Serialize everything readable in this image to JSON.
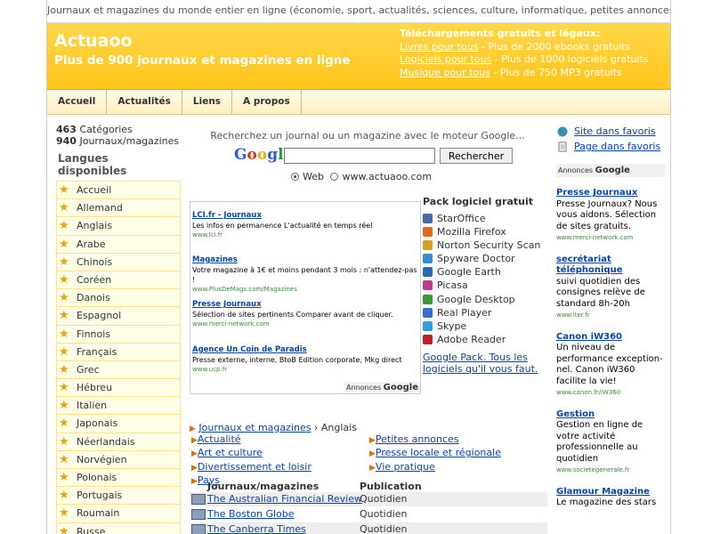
{
  "topbar": "Journaux et magazines du monde entier en ligne (économie, sport, actualités, sciences, culture, informatique, petites annonces...)",
  "header": {
    "title": "Actuaoo",
    "subtitle": "Plus de 900 journaux et magazines en ligne",
    "downloads_title": "Téléchargements gratuits et légaux:",
    "downloads": [
      {
        "link": "Livres pour tous",
        "text": " - Plus de 2000 ebooks gratuits"
      },
      {
        "link": "Logiciels pour tous",
        "text": " - Plus de 1000 logiciels gratuits"
      },
      {
        "link": "Musique pour tous",
        "text": " - Plus de 750 MP3 gratuits"
      }
    ]
  },
  "nav": [
    "Accueil",
    "Actualités",
    "Liens",
    "A propos"
  ],
  "stats": {
    "categories_count": "463",
    "categories_label": " Catégories",
    "journals_count": "940",
    "journals_label": " Journaux/magazines"
  },
  "languages_title": "Langues disponibles",
  "languages": [
    "Accueil",
    "Allemand",
    "Anglais",
    "Arabe",
    "Chinois",
    "Coréen",
    "Danois",
    "Espagnol",
    "Finnois",
    "Français",
    "Grec",
    "Hébreu",
    "Italien",
    "Japonais",
    "Néerlandais",
    "Norvégien",
    "Polonais",
    "Portugais",
    "Roumain",
    "Russe"
  ],
  "search": {
    "hint": "Recherchez un journal ou un magazine avec le moteur Google...",
    "logo": "Google",
    "button": "Rechercher",
    "value": "",
    "option_web": "Web",
    "option_site": "www.actuaoo.com"
  },
  "ads": [
    {
      "title": "LCI.fr - Journaux",
      "desc": "Les infos en permanence L'actualité en temps réel",
      "url": "www.lci.fr"
    },
    {
      "title": "Magazines",
      "desc": "Votre magazine à 1€ et moins pendant 3 mois : n'attendez-pas !",
      "url": "www.PlusDeMags.com/Magazines"
    },
    {
      "title": "Presse Journaux",
      "desc": "Sélection de sites pertinents Comparer avant de cliquer.",
      "url": "www.merci-network.com"
    },
    {
      "title": "Agence Un Coin de Paradis",
      "desc": "Presse externe, interne, BtoB Edition corporate, Mkg direct",
      "url": "www.ucp.fr"
    }
  ],
  "ads_google_label": "Annonces",
  "ads_google_brand": "Google",
  "pack": {
    "title": "Pack logiciel gratuit",
    "items": [
      "StarOffice",
      "Mozilla Firefox",
      "Norton Security Scan",
      "Spyware Doctor",
      "Google Earth",
      "Picasa",
      "Google Desktop",
      "Real Player",
      "Skype",
      "Adobe Reader"
    ],
    "icon_colors": [
      "#4a6aa0",
      "#e06a20",
      "#d4a020",
      "#3a8ad0",
      "#2a6ab0",
      "#c03a8a",
      "#3a9a3a",
      "#3a6ad0",
      "#2aa0e0",
      "#c02020"
    ],
    "link": "Google Pack. Tous les logiciels qu'il vous faut."
  },
  "breadcrumb": {
    "root": "Journaux et magazines",
    "sep": " › ",
    "current": "Anglais"
  },
  "categories_left": [
    "Actualité",
    "Art et culture",
    "Divertissement et loisir",
    "Pays"
  ],
  "categories_right": [
    "Petites annonces",
    "Presse locale et régionale",
    "Vie pratique"
  ],
  "table": {
    "col_name": "Journaux/magazines",
    "col_pub": "Publication",
    "rows": [
      {
        "name": "The Australian Financial Review",
        "pub": "Quotidien"
      },
      {
        "name": "The Boston Globe",
        "pub": "Quotidien"
      },
      {
        "name": "The Canberra Times",
        "pub": "Quotidien"
      }
    ]
  },
  "favorites": [
    "Site dans favoris",
    "Page dans favoris"
  ],
  "right_ads": [
    {
      "title": "Presse Journaux",
      "desc": "Presse Journaux? Nous vous aidons. Sélection de sites gratuits.",
      "url": "www.merci-network.com"
    },
    {
      "title": "secrétariat téléphonique",
      "desc": "suivi quotidien des consignes relève de standard 8h-20h",
      "url": "www.iter.fr"
    },
    {
      "title": "Canon iW360",
      "desc": "Un niveau de performance exception- nel. Canon iW360 facilite la vie!",
      "url": "www.canon.fr/iW360"
    },
    {
      "title": "Gestion",
      "desc": "Gestion en ligne de votre activité professionnelle au quotidien",
      "url": "www.societegenerale.fr"
    },
    {
      "title": "Glamour Magazine",
      "desc": "Le magazine des stars",
      "url": ""
    }
  ]
}
